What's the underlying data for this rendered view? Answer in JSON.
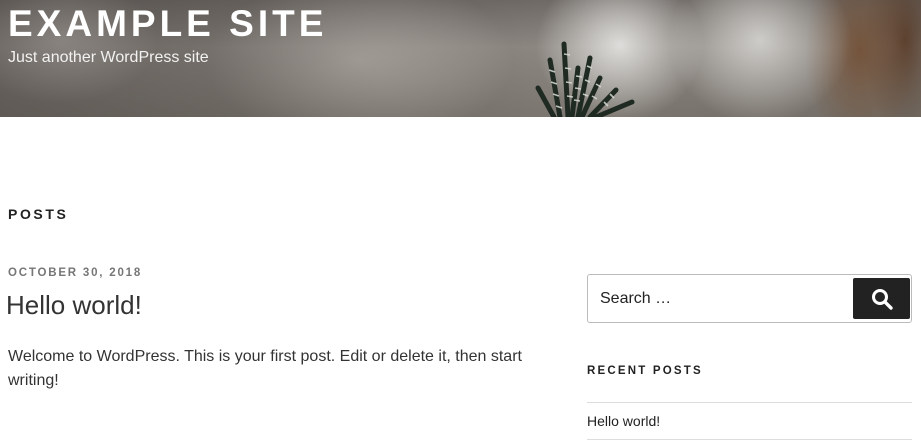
{
  "header": {
    "site_title": "EXAMPLE SITE",
    "site_description": "Just another WordPress site"
  },
  "main": {
    "page_title": "POSTS",
    "posts": [
      {
        "date": "OCTOBER 30, 2018",
        "title": "Hello world!",
        "excerpt": "Welcome to WordPress. This is your first post. Edit or delete it, then start writing!"
      }
    ]
  },
  "sidebar": {
    "search": {
      "placeholder": "Search …",
      "button_icon": "search-icon"
    },
    "recent_posts": {
      "title": "RECENT POSTS",
      "items": [
        {
          "label": "Hello world!"
        }
      ]
    }
  },
  "colors": {
    "text": "#222222",
    "meta": "#767676",
    "button_bg": "#222222",
    "border": "#dddddd"
  }
}
